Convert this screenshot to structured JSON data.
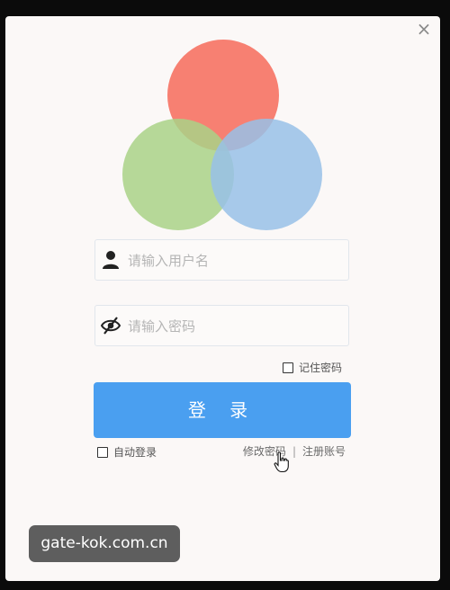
{
  "window": {
    "close_label": "×"
  },
  "logo": {
    "circles": [
      "#f7796a",
      "#a9d287",
      "#98c1e8"
    ]
  },
  "username": {
    "placeholder": "请输入用户名",
    "icon": "user-icon"
  },
  "password": {
    "placeholder": "请输入密码",
    "icon": "eye-off-icon"
  },
  "remember": {
    "label": "记住密码"
  },
  "login": {
    "label": "登 录",
    "color": "#4a9ff0"
  },
  "auto_login": {
    "label": "自动登录"
  },
  "links": {
    "change_password": "修改密码",
    "separator": "|",
    "register": "注册账号"
  },
  "watermark": {
    "text": "gate-kok.com.cn"
  }
}
